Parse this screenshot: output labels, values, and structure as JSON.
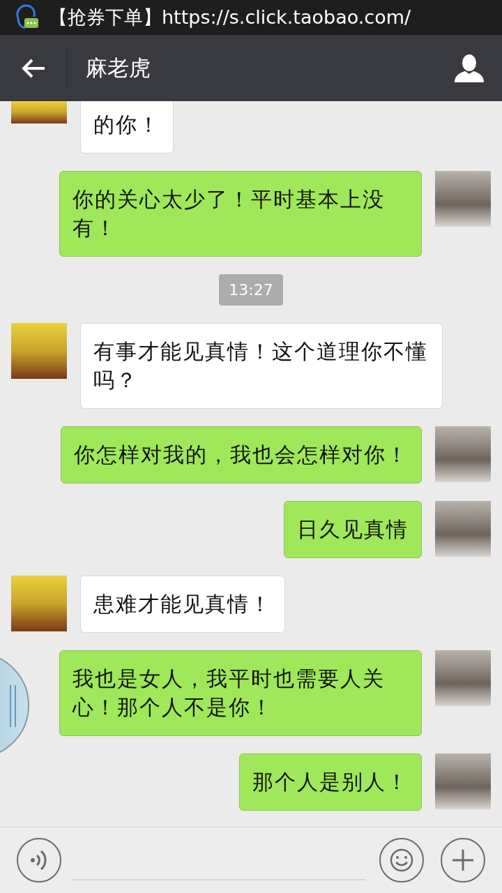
{
  "status_bar": {
    "notification": "【抢券下单】https://s.click.taobao.com/"
  },
  "header": {
    "title": "麻老虎"
  },
  "messages": [
    {
      "kind": "text",
      "outgoing": false,
      "clipped": true,
      "text": "的你！"
    },
    {
      "kind": "text",
      "outgoing": true,
      "clipped": false,
      "text": "你的关心太少了！平时基本上没有！"
    },
    {
      "kind": "time",
      "text": "13:27"
    },
    {
      "kind": "text",
      "outgoing": false,
      "clipped": false,
      "text": "有事才能见真情！这个道理你不懂吗？"
    },
    {
      "kind": "text",
      "outgoing": true,
      "clipped": false,
      "text": "你怎样对我的，我也会怎样对你！"
    },
    {
      "kind": "text",
      "outgoing": true,
      "clipped": false,
      "text": "日久见真情"
    },
    {
      "kind": "text",
      "outgoing": false,
      "clipped": false,
      "text": "患难才能见真情！"
    },
    {
      "kind": "text",
      "outgoing": true,
      "clipped": false,
      "text": "我也是女人，我平时也需要人关心！那个人不是你！"
    },
    {
      "kind": "text",
      "outgoing": true,
      "clipped": false,
      "text": "那个人是别人！"
    }
  ]
}
